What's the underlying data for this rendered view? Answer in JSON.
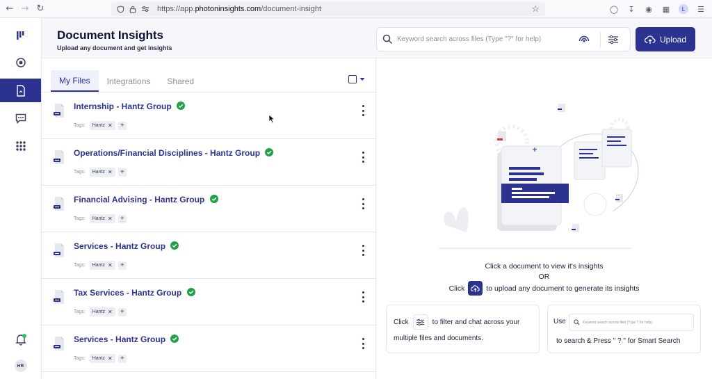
{
  "browser": {
    "url_prefix": "https://app.",
    "url_domain": "photoninsights.com",
    "url_path": "/document-insight",
    "avatar_initials": "L"
  },
  "sidebar": {
    "user_initials": "HR"
  },
  "header": {
    "title": "Document Insights",
    "subtitle": "Upload any document and get insights",
    "search_placeholder": "Keyword search across files (Type \"?\" for help)",
    "upload_label": "Upload"
  },
  "files_panel": {
    "tabs": [
      {
        "label": "My Files"
      },
      {
        "label": "Integrations"
      },
      {
        "label": "Shared"
      }
    ],
    "tags_label": "Tags:",
    "files": [
      {
        "name": "Internship - Hantz Group",
        "tag": "Hantz"
      },
      {
        "name": "Operations/Financial Disciplines - Hantz Group",
        "tag": "Hantz"
      },
      {
        "name": "Financial Advising - Hantz Group",
        "tag": "Hantz"
      },
      {
        "name": "Services - Hantz Group",
        "tag": "Hantz"
      },
      {
        "name": "Tax Services - Hantz Group",
        "tag": "Hantz"
      },
      {
        "name": "Services - Hantz Group",
        "tag": "Hantz"
      }
    ]
  },
  "insight_panel": {
    "line1": "Click a document to view it's insights",
    "line2": "OR",
    "line3_pre": "Click",
    "line3_post": "to upload any document to generate its insights",
    "card1_pre": "Click",
    "card1_post": "to filter and chat across your",
    "card1_line2": "multiple files and documents.",
    "card2_pre": "Use",
    "card2_mini_placeholder": "Keyword search across files (Type ? for help)",
    "card2_line2": "to search & Press \" ? \" for Smart Search"
  },
  "colors": {
    "brand": "#2b3290",
    "success": "#22a046",
    "notification": "#22c55e"
  }
}
